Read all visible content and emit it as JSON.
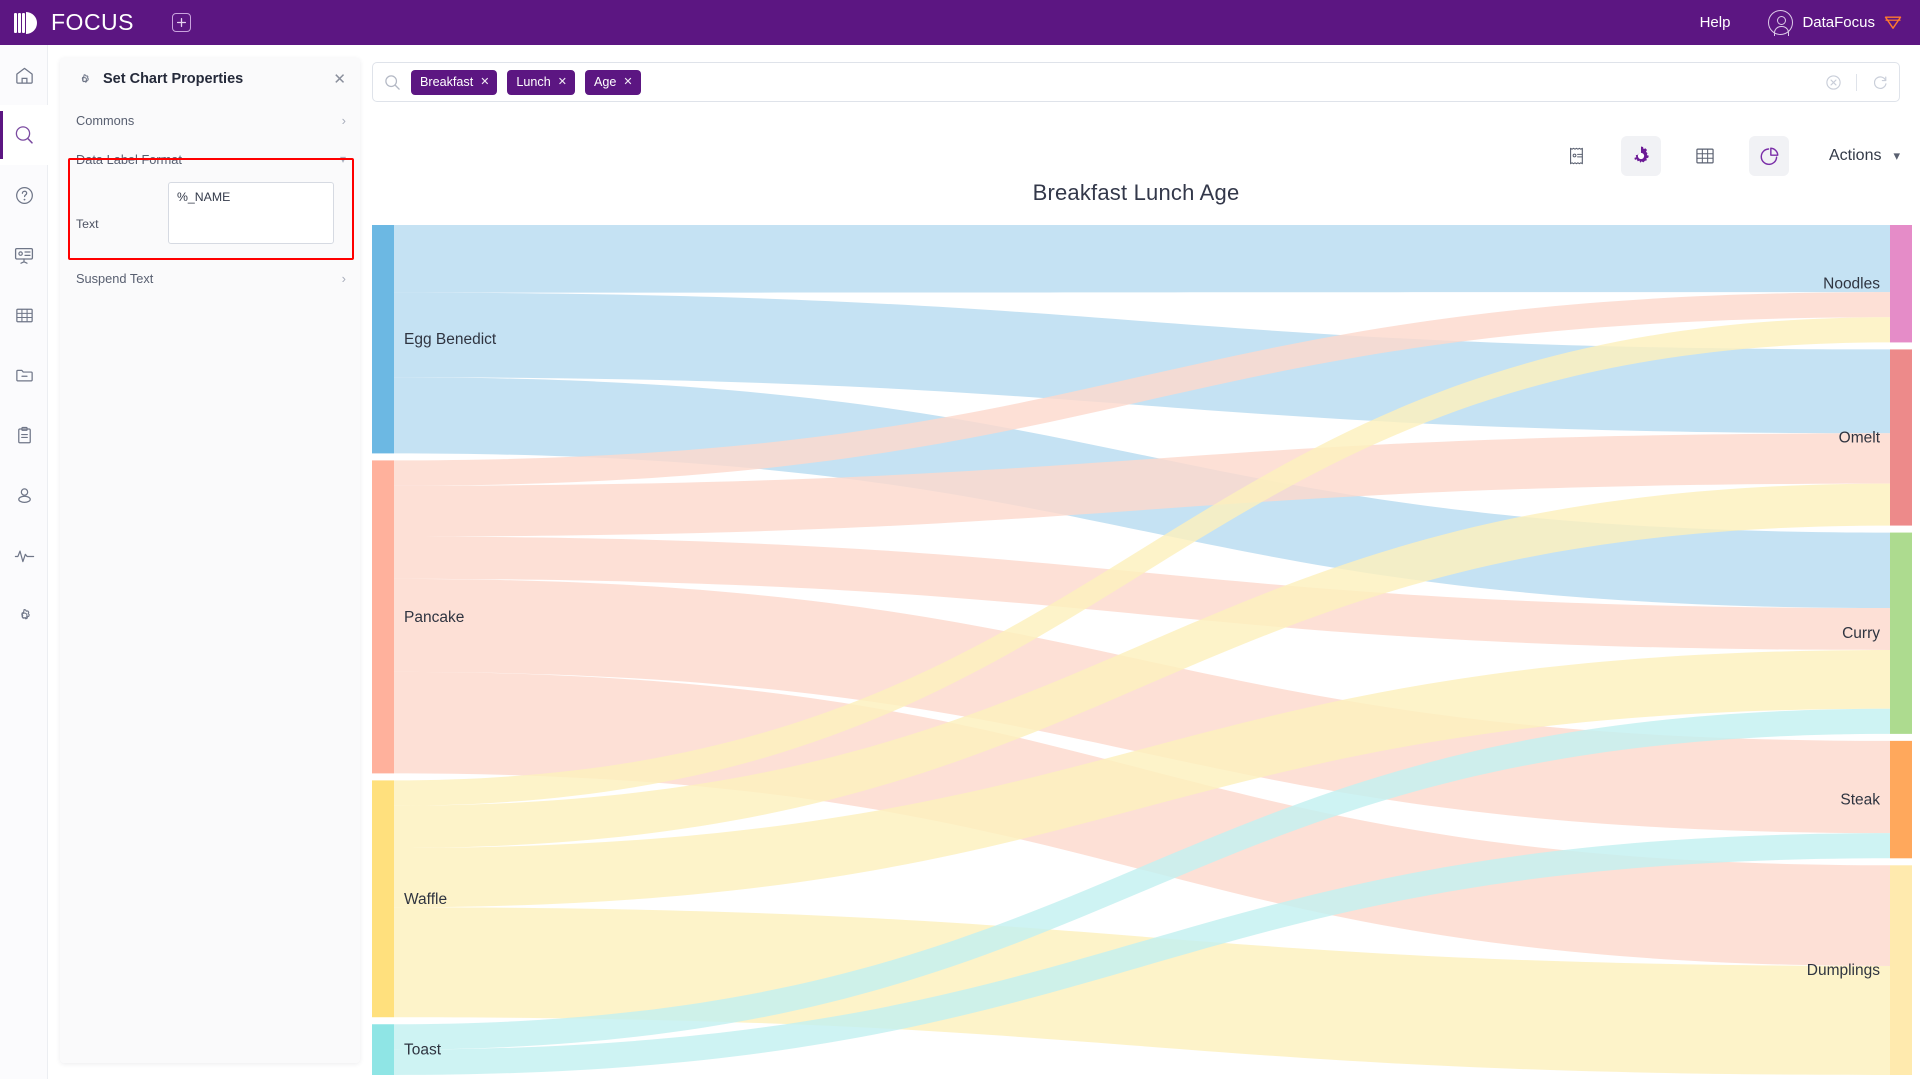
{
  "topbar": {
    "brand": "FOCUS",
    "add_tab_icon": "plus-square-icon",
    "help_label": "Help",
    "user_name": "DataFocus",
    "user_icon": "user-circle-icon",
    "gem_icon": "gem-icon",
    "background": "#5c1682"
  },
  "rail": {
    "items": [
      {
        "name": "home",
        "icon": "home-icon",
        "active": false
      },
      {
        "name": "search",
        "icon": "search-icon",
        "active": true
      },
      {
        "name": "help",
        "icon": "question-circle-icon",
        "active": false
      },
      {
        "name": "dashboard",
        "icon": "presentation-icon",
        "active": false
      },
      {
        "name": "table",
        "icon": "grid-table-icon",
        "active": false
      },
      {
        "name": "folder",
        "icon": "folder-minus-icon",
        "active": false
      },
      {
        "name": "clipboard",
        "icon": "clipboard-icon",
        "active": false
      },
      {
        "name": "user",
        "icon": "user-icon",
        "active": false
      },
      {
        "name": "monitor",
        "icon": "activity-pulse-icon",
        "active": false
      },
      {
        "name": "settings",
        "icon": "gear-icon",
        "active": false
      }
    ]
  },
  "panel": {
    "title": "Set Chart Properties",
    "gear_icon": "gear-icon",
    "close_icon": "close-icon",
    "sections": {
      "commons": {
        "label": "Commons",
        "chevron": "chevron-right-icon"
      },
      "data_label_format": {
        "label": "Data Label Format",
        "chevron": "chevron-down-icon"
      },
      "suspend_text": {
        "label": "Suspend Text",
        "chevron": "chevron-right-icon"
      }
    },
    "text_field": {
      "label": "Text",
      "value": "%_NAME",
      "placeholder": ""
    },
    "highlight_color": "#ff0000"
  },
  "search": {
    "search_icon": "search-icon",
    "placeholder": "",
    "tags": [
      {
        "label": "Breakfast",
        "remove_icon": "close-icon"
      },
      {
        "label": "Lunch",
        "remove_icon": "close-icon"
      },
      {
        "label": "Age",
        "remove_icon": "close-icon"
      }
    ],
    "clear_icon": "clear-circle-icon",
    "refresh_icon": "refresh-icon"
  },
  "chart_toolbar": {
    "buttons": [
      {
        "name": "receipt-view",
        "icon": "receipt-icon",
        "selected": false
      },
      {
        "name": "chart-settings",
        "icon": "gear-icon",
        "selected": true
      },
      {
        "name": "table-view",
        "icon": "grid-table-icon",
        "selected": false
      },
      {
        "name": "chart-view",
        "icon": "pie-chart-icon",
        "selected": true
      }
    ],
    "actions_label": "Actions",
    "actions_chevron": "chevron-down-icon"
  },
  "chart_data": {
    "type": "sankey",
    "title": "Breakfast Lunch Age",
    "xlabel": "",
    "ylabel": "",
    "grid": false,
    "legend": "none",
    "nodes": [
      {
        "name": "Egg Benedict",
        "side": "left",
        "color": "#6cb8e3",
        "value": 27
      },
      {
        "name": "Pancake",
        "side": "left",
        "color": "#ffb19c",
        "value": 37
      },
      {
        "name": "Waffle",
        "side": "left",
        "color": "#ffe07d",
        "value": 28
      },
      {
        "name": "Toast",
        "side": "left",
        "color": "#8fe5e5",
        "value": 6
      },
      {
        "name": "Noodles",
        "side": "right",
        "color": "#e58cc8",
        "value": 14
      },
      {
        "name": "Omelt",
        "side": "right",
        "color": "#ed8a8a",
        "value": 21
      },
      {
        "name": "Curry",
        "side": "right",
        "color": "#addb8f",
        "value": 24
      },
      {
        "name": "Steak",
        "side": "right",
        "color": "#ffa85c",
        "value": 14
      },
      {
        "name": "Dumplings",
        "side": "right",
        "color": "#ffeaae",
        "value": 25
      }
    ],
    "links": [
      {
        "source": "Egg Benedict",
        "target": "Noodles",
        "value": 8,
        "color": "#b8dcf0"
      },
      {
        "source": "Egg Benedict",
        "target": "Omelt",
        "value": 10,
        "color": "#b8dcf0"
      },
      {
        "source": "Egg Benedict",
        "target": "Curry",
        "value": 9,
        "color": "#b8dcf0"
      },
      {
        "source": "Pancake",
        "target": "Noodles",
        "value": 3,
        "color": "#fdd9cd"
      },
      {
        "source": "Pancake",
        "target": "Omelt",
        "value": 6,
        "color": "#fdd9cd"
      },
      {
        "source": "Pancake",
        "target": "Curry",
        "value": 5,
        "color": "#fdd9cd"
      },
      {
        "source": "Pancake",
        "target": "Steak",
        "value": 11,
        "color": "#fdd9cd"
      },
      {
        "source": "Pancake",
        "target": "Dumplings",
        "value": 12,
        "color": "#fdd9cd"
      },
      {
        "source": "Waffle",
        "target": "Noodles",
        "value": 3,
        "color": "#fdf0bd"
      },
      {
        "source": "Waffle",
        "target": "Omelt",
        "value": 5,
        "color": "#fdf0bd"
      },
      {
        "source": "Waffle",
        "target": "Curry",
        "value": 7,
        "color": "#fdf0bd"
      },
      {
        "source": "Waffle",
        "target": "Dumplings",
        "value": 13,
        "color": "#fdf0bd"
      },
      {
        "source": "Toast",
        "target": "Curry",
        "value": 3,
        "color": "#c3f0f0"
      },
      {
        "source": "Toast",
        "target": "Steak",
        "value": 3,
        "color": "#c3f0f0"
      }
    ]
  }
}
